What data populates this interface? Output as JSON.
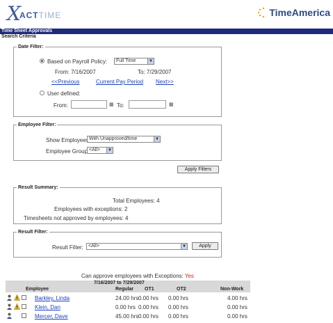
{
  "header": {
    "logo_x": "X",
    "logo_act": "ACT",
    "logo_time": "TIME",
    "brand": "TimeAmerica"
  },
  "titlebar": {
    "title": "Time Sheet Approvals"
  },
  "search_criteria": {
    "label": "Search Criteria"
  },
  "date_filter": {
    "legend": "Date Filter:",
    "payroll_label": "Based on Payroll Policy:",
    "payroll_selected": "Full Time",
    "from_label": "From: 7/16/2007",
    "to_label": "To: 7/29/2007",
    "prev_link": "<<Previous",
    "current_link": "Current Pay Period",
    "next_link": "Next>>",
    "user_defined_label": "User defined:",
    "from_input_label": "From:",
    "to_input_label": "To:",
    "from_value": "",
    "to_value": ""
  },
  "employee_filter": {
    "legend": "Employee Filter:",
    "show_label": "Show Employees:",
    "show_selected": "With Unapproved/time",
    "group_label": "Employee Group:",
    "group_selected": "<All>"
  },
  "apply_filters_label": "Apply Filters",
  "result_summary": {
    "legend": "Result Summary:",
    "total": "Total Employees: 4",
    "exceptions": "Employees with exceptions: 2",
    "not_approved": "Timesheets not approved by employees: 4"
  },
  "result_filter": {
    "legend": "Result Filter:",
    "label": "Result Filter:",
    "selected": "<All>",
    "apply_label": "Apply"
  },
  "approve_note": {
    "text": "Can approve employees with Exceptions:",
    "value": "Yes"
  },
  "period": "7/16/2007 to 7/29/2007",
  "table": {
    "columns": [
      "Employee",
      "Regular",
      "OT1",
      "OT2",
      "Non-Work"
    ],
    "rows": [
      {
        "name": "Barkley, Linda",
        "regular": "24.00 hrs",
        "ot1": "0.00 hrs",
        "ot2": "0.00 hrs",
        "nonwork": "4.00 hrs",
        "warning": true
      },
      {
        "name": "Klein, Dan",
        "regular": "0.00 hrs",
        "ot1": "0.00 hrs",
        "ot2": "0.00 hrs",
        "nonwork": "0.00 hrs",
        "warning": true
      },
      {
        "name": "Mercer, Dave",
        "regular": "45.00 hrs",
        "ot1": "0.00 hrs",
        "ot2": "0.00 hrs",
        "nonwork": "0.00 hrs",
        "warning": false
      }
    ]
  },
  "colors": {
    "titlebar": "#1f2a7a",
    "link": "#1a3fbf",
    "accent_red": "#d21"
  },
  "icons": [
    "user-icon",
    "warning-icon",
    "checkbox",
    "calendar-icon",
    "dropdown-arrow-icon"
  ]
}
